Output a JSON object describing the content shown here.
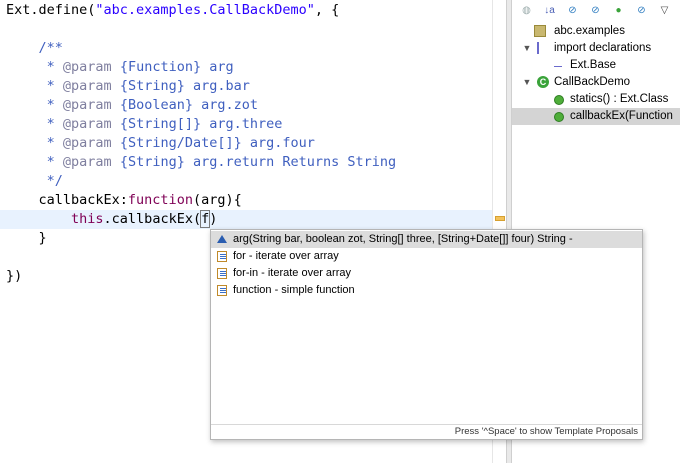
{
  "editor": {
    "lines": [
      {
        "segments": [
          {
            "t": "Ext.define(",
            "c": "plain"
          },
          {
            "t": "\"abc.examples.CallBackDemo\"",
            "c": "str"
          },
          {
            "t": ", {",
            "c": "plain"
          }
        ]
      },
      {
        "segments": []
      },
      {
        "segments": [
          {
            "t": "    /**",
            "c": "cmt"
          }
        ]
      },
      {
        "segments": [
          {
            "t": "     * ",
            "c": "cmt"
          },
          {
            "t": "@param",
            "c": "tag"
          },
          {
            "t": " {Function} arg",
            "c": "cmt"
          }
        ]
      },
      {
        "segments": [
          {
            "t": "     * ",
            "c": "cmt"
          },
          {
            "t": "@param",
            "c": "tag"
          },
          {
            "t": " {String} arg.bar",
            "c": "cmt"
          }
        ]
      },
      {
        "segments": [
          {
            "t": "     * ",
            "c": "cmt"
          },
          {
            "t": "@param",
            "c": "tag"
          },
          {
            "t": " {Boolean} arg.zot",
            "c": "cmt"
          }
        ]
      },
      {
        "segments": [
          {
            "t": "     * ",
            "c": "cmt"
          },
          {
            "t": "@param",
            "c": "tag"
          },
          {
            "t": " {String[]} arg.three",
            "c": "cmt"
          }
        ]
      },
      {
        "segments": [
          {
            "t": "     * ",
            "c": "cmt"
          },
          {
            "t": "@param",
            "c": "tag"
          },
          {
            "t": " {String/Date[]} arg.four",
            "c": "cmt"
          }
        ]
      },
      {
        "segments": [
          {
            "t": "     * ",
            "c": "cmt"
          },
          {
            "t": "@param",
            "c": "tag"
          },
          {
            "t": " {String} arg.return Returns String",
            "c": "cmt"
          }
        ]
      },
      {
        "segments": [
          {
            "t": "     */",
            "c": "cmt"
          }
        ]
      },
      {
        "segments": [
          {
            "t": "    callbackEx:",
            "c": "plain"
          },
          {
            "t": "function",
            "c": "kw"
          },
          {
            "t": "(arg){",
            "c": "plain"
          }
        ]
      },
      {
        "segments": [
          {
            "t": "        ",
            "c": "plain"
          },
          {
            "t": "this",
            "c": "kw"
          },
          {
            "t": ".callbackEx(",
            "c": "plain"
          },
          {
            "t": "f",
            "c": "caret"
          },
          {
            "t": ")",
            "c": "plain"
          }
        ],
        "highlight": true
      },
      {
        "segments": [
          {
            "t": "    }",
            "c": "plain"
          }
        ]
      },
      {
        "segments": []
      },
      {
        "segments": [
          {
            "t": "})",
            "c": "plain"
          }
        ]
      }
    ]
  },
  "outline": {
    "toolbar_icons": [
      "group-icon",
      "sort-alpha-icon",
      "hide-fields-icon",
      "hide-static-icon",
      "public-icon",
      "hide-local-icon",
      "view-menu-icon"
    ],
    "items": [
      {
        "label": "abc.examples",
        "icon": "package-icon",
        "indent": 0,
        "arrow": ""
      },
      {
        "label": "import declarations",
        "icon": "imports-icon",
        "indent": 0,
        "arrow": "▼"
      },
      {
        "label": "Ext.Base",
        "icon": "import-icon",
        "indent": 1,
        "arrow": ""
      },
      {
        "label": "CallBackDemo",
        "icon": "class-icon",
        "indent": 0,
        "arrow": "▼"
      },
      {
        "label": "statics() : Ext.Class",
        "icon": "method-icon",
        "indent": 1,
        "arrow": ""
      },
      {
        "label": "callbackEx(Function",
        "icon": "method-icon",
        "indent": 1,
        "arrow": "",
        "selected": true
      }
    ]
  },
  "popup": {
    "proposals": [
      {
        "label": "arg(String bar, boolean zot, String[] three, [String+Date[]] four) String -",
        "icon": "arg-proposal-icon",
        "selected": true
      },
      {
        "label": "for - iterate over array",
        "icon": "template-icon"
      },
      {
        "label": "for-in - iterate over array",
        "icon": "template-icon"
      },
      {
        "label": "function - simple function",
        "icon": "template-icon"
      }
    ],
    "status": "Press '^Space' to show Template Proposals"
  }
}
